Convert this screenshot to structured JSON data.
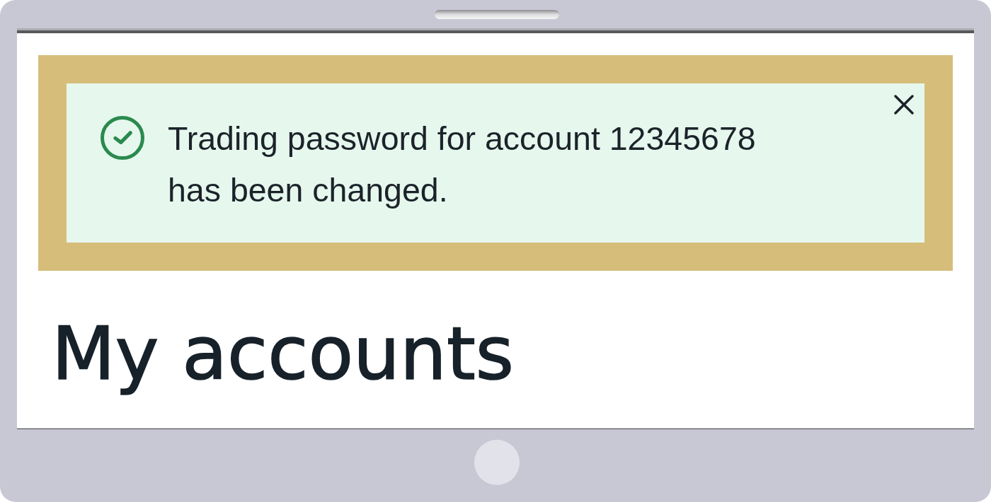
{
  "alert": {
    "kind": "success",
    "highlighted": true,
    "dismissible": true,
    "message": "Trading password for account 12345678 has been changed."
  },
  "heading": "My accounts"
}
